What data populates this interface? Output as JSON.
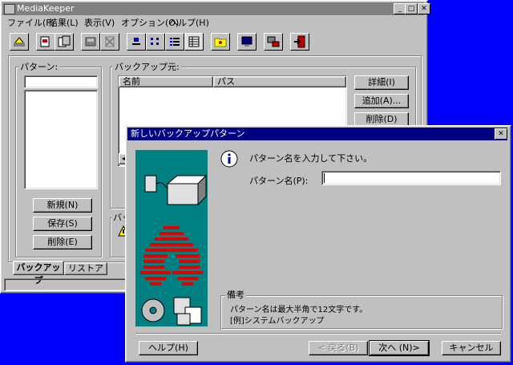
{
  "main_window": {
    "title": "MediaKeeper",
    "menu": [
      "ファイル(F)",
      "結果(L)",
      "表示(V)",
      "オプション(O)",
      "ヘルプ(H)"
    ],
    "toolbar_icons": [
      "backup-icon",
      "restore-icon",
      "copy-icon",
      "disk-icon",
      "delete-icon",
      "large-icons-icon",
      "small-icons-icon",
      "list-icon",
      "details-icon",
      "folder-icon",
      "monitor-icon",
      "network-icon",
      "exit-icon"
    ],
    "pattern_label": "パターン:",
    "source_label": "バックアップ元:",
    "columns": [
      "名前",
      "パス"
    ],
    "side_buttons": [
      "詳細(I)",
      "追加(A)...",
      "削除(D)"
    ],
    "pattern_buttons": [
      "新規(N)",
      "保存(S)",
      "削除(E)"
    ],
    "dest_label": "バックア",
    "tabs": [
      "バックアップ",
      "リストア"
    ]
  },
  "dialog": {
    "title": "新しいバックアップパターン",
    "prompt": "パターン名を入力して下さい。",
    "name_label": "パターン名(P):",
    "name_value": "",
    "notes_label": "備考",
    "notes_line1": "パターン名は最大半角で12文字です。",
    "notes_line2": "[例]システムバックアップ",
    "buttons": {
      "help": "ヘルプ(H)",
      "back": "< 戻る(B)",
      "next": "次へ (N)>",
      "cancel": "キャンセル"
    }
  }
}
